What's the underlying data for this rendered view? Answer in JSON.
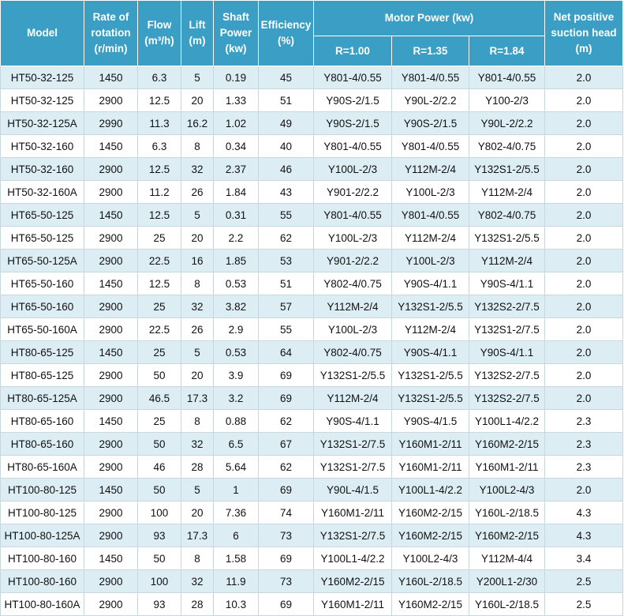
{
  "headers": {
    "model": "Model",
    "rate_line1": "Rate of",
    "rate_line2": "rotation",
    "rate_line3": "(r/min)",
    "flow_line1": "Flow",
    "flow_line2": "(m³/h)",
    "lift_line1": "Lift",
    "lift_line2": "(m)",
    "shaft_line1": "Shaft",
    "shaft_line2": "Power",
    "shaft_line3": "(kw)",
    "eff_line1": "Efficiency",
    "eff_line2": "(%)",
    "motor": "Motor Power (kw)",
    "r1": "R=1.00",
    "r2": "R=1.35",
    "r3": "R=1.84",
    "npsh_line1": "Net positive",
    "npsh_line2": "suction head",
    "npsh_line3": "(m)"
  },
  "rows": [
    [
      "HT50-32-125",
      "1450",
      "6.3",
      "5",
      "0.19",
      "45",
      "Y801-4/0.55",
      "Y801-4/0.55",
      "Y801-4/0.55",
      "2.0"
    ],
    [
      "HT50-32-125",
      "2900",
      "12.5",
      "20",
      "1.33",
      "51",
      "Y90S-2/1.5",
      "Y90L-2/2.2",
      "Y100-2/3",
      "2.0"
    ],
    [
      "HT50-32-125A",
      "2990",
      "11.3",
      "16.2",
      "1.02",
      "49",
      "Y90S-2/1.5",
      "Y90S-2/1.5",
      "Y90L-2/2.2",
      "2.0"
    ],
    [
      "HT50-32-160",
      "1450",
      "6.3",
      "8",
      "0.34",
      "40",
      "Y801-4/0.55",
      "Y801-4/0.55",
      "Y802-4/0.75",
      "2.0"
    ],
    [
      "HT50-32-160",
      "2900",
      "12.5",
      "32",
      "2.37",
      "46",
      "Y100L-2/3",
      "Y112M-2/4",
      "Y132S1-2/5.5",
      "2.0"
    ],
    [
      "HT50-32-160A",
      "2900",
      "11.2",
      "26",
      "1.84",
      "43",
      "Y901-2/2.2",
      "Y100L-2/3",
      "Y112M-2/4",
      "2.0"
    ],
    [
      "HT65-50-125",
      "1450",
      "12.5",
      "5",
      "0.31",
      "55",
      "Y801-4/0.55",
      "Y801-4/0.55",
      "Y802-4/0.75",
      "2.0"
    ],
    [
      "HT65-50-125",
      "2900",
      "25",
      "20",
      "2.2",
      "62",
      "Y100L-2/3",
      "Y112M-2/4",
      "Y132S1-2/5.5",
      "2.0"
    ],
    [
      "HT65-50-125A",
      "2900",
      "22.5",
      "16",
      "1.85",
      "53",
      "Y901-2/2.2",
      "Y100L-2/3",
      "Y112M-2/4",
      "2.0"
    ],
    [
      "HT65-50-160",
      "1450",
      "12.5",
      "8",
      "0.53",
      "51",
      "Y802-4/0.75",
      "Y90S-4/1.1",
      "Y90S-4/1.1",
      "2.0"
    ],
    [
      "HT65-50-160",
      "2900",
      "25",
      "32",
      "3.82",
      "57",
      "Y112M-2/4",
      "Y132S1-2/5.5",
      "Y132S2-2/7.5",
      "2.0"
    ],
    [
      "HT65-50-160A",
      "2900",
      "22.5",
      "26",
      "2.9",
      "55",
      "Y100L-2/3",
      "Y112M-2/4",
      "Y132S1-2/7.5",
      "2.0"
    ],
    [
      "HT80-65-125",
      "1450",
      "25",
      "5",
      "0.53",
      "64",
      "Y802-4/0.75",
      "Y90S-4/1.1",
      "Y90S-4/1.1",
      "2.0"
    ],
    [
      "HT80-65-125",
      "2900",
      "50",
      "20",
      "3.9",
      "69",
      "Y132S1-2/5.5",
      "Y132S1-2/5.5",
      "Y132S2-2/7.5",
      "2.0"
    ],
    [
      "HT80-65-125A",
      "2900",
      "46.5",
      "17.3",
      "3.2",
      "69",
      "Y112M-2/4",
      "Y132S1-2/5.5",
      "Y132S2-2/7.5",
      "2.0"
    ],
    [
      "HT80-65-160",
      "1450",
      "25",
      "8",
      "0.88",
      "62",
      "Y90S-4/1.1",
      "Y90S-4/1.5",
      "Y100L1-4/2.2",
      "2.3"
    ],
    [
      "HT80-65-160",
      "2900",
      "50",
      "32",
      "6.5",
      "67",
      "Y132S1-2/7.5",
      "Y160M1-2/11",
      "Y160M2-2/15",
      "2.3"
    ],
    [
      "HT80-65-160A",
      "2900",
      "46",
      "28",
      "5.64",
      "62",
      "Y132S1-2/7.5",
      "Y160M1-2/11",
      "Y160M1-2/11",
      "2.3"
    ],
    [
      "HT100-80-125",
      "1450",
      "50",
      "5",
      "1",
      "69",
      "Y90L-4/1.5",
      "Y100L1-4/2.2",
      "Y100L2-4/3",
      "2.0"
    ],
    [
      "HT100-80-125",
      "2900",
      "100",
      "20",
      "7.36",
      "74",
      "Y160M1-2/11",
      "Y160M2-2/15",
      "Y160L-2/18.5",
      "4.3"
    ],
    [
      "HT100-80-125A",
      "2900",
      "93",
      "17.3",
      "6",
      "73",
      "Y132S1-2/7.5",
      "Y160M2-2/15",
      "Y160M2-2/15",
      "4.3"
    ],
    [
      "HT100-80-160",
      "1450",
      "50",
      "8",
      "1.58",
      "69",
      "Y100L1-4/2.2",
      "Y100L2-4/3",
      "Y112M-4/4",
      "3.4"
    ],
    [
      "HT100-80-160",
      "2900",
      "100",
      "32",
      "11.9",
      "73",
      "Y160M2-2/15",
      "Y160L-2/18.5",
      "Y200L1-2/30",
      "2.5"
    ],
    [
      "HT100-80-160A",
      "2900",
      "93",
      "28",
      "10.3",
      "69",
      "Y160M1-2/11",
      "Y160M2-2/15",
      "Y160L-2/18.5",
      "2.5"
    ]
  ]
}
